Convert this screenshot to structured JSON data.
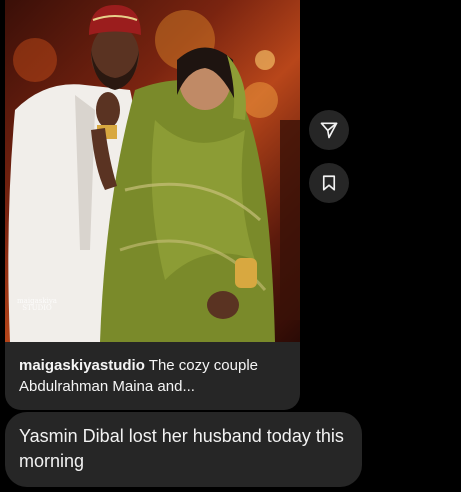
{
  "shared_post": {
    "image_alt": "Couple photo: man in white kaftan and red cap, woman in green embellished gown",
    "watermark": "maigaskiya STUDIO",
    "caption_user": "maigaskiyastudio",
    "caption_text": " The cozy couple Abdulrahman Maina and..."
  },
  "actions": {
    "share_icon": "send-icon",
    "save_icon": "bookmark-icon"
  },
  "message": {
    "text": "Yasmin Dibal lost her husband today this morning"
  },
  "colors": {
    "background": "#000000",
    "bubble": "#262626",
    "text": "#f2f2f2",
    "dress_green": "#7a8a2a"
  }
}
